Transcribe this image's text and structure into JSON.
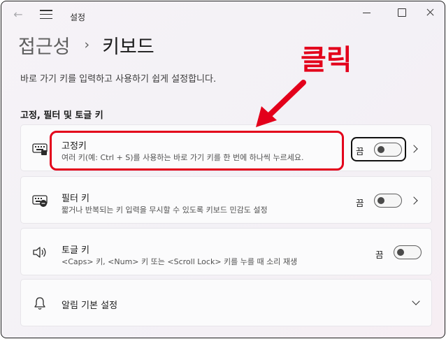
{
  "window": {
    "title": "설정"
  },
  "header": {
    "breadcrumb_parent": "접근성",
    "breadcrumb_separator": "›",
    "breadcrumb_current": "키보드",
    "description": "바로 가기 키를 입력하고 사용하기 쉽게 설정합니다."
  },
  "section": {
    "heading": "고정, 필터 및 토글 키"
  },
  "settings": [
    {
      "title": "고정키",
      "subtitle": "여러 키(예: Ctrl + S)를 사용하는 바로 가기 키를 한 번에 하나씩 누르세요.",
      "toggle_label": "끔",
      "icon": "keyboard-icon"
    },
    {
      "title": "필터 키",
      "subtitle": "짧거나 반복되는 키 입력을 무시할 수 있도록 키보드 민감도 설정",
      "toggle_label": "끔",
      "icon": "keyboard-filter-icon"
    },
    {
      "title": "토글 키",
      "subtitle": "<Caps> 키, <Num> 키 또는 <Scroll Lock> 키를 누를 때 소리 재생",
      "toggle_label": "끔",
      "icon": "speaker-icon"
    },
    {
      "title": "알림 기본 설정",
      "icon": "bell-icon"
    }
  ],
  "annotation": {
    "label": "클릭",
    "color": "#e3001b"
  }
}
